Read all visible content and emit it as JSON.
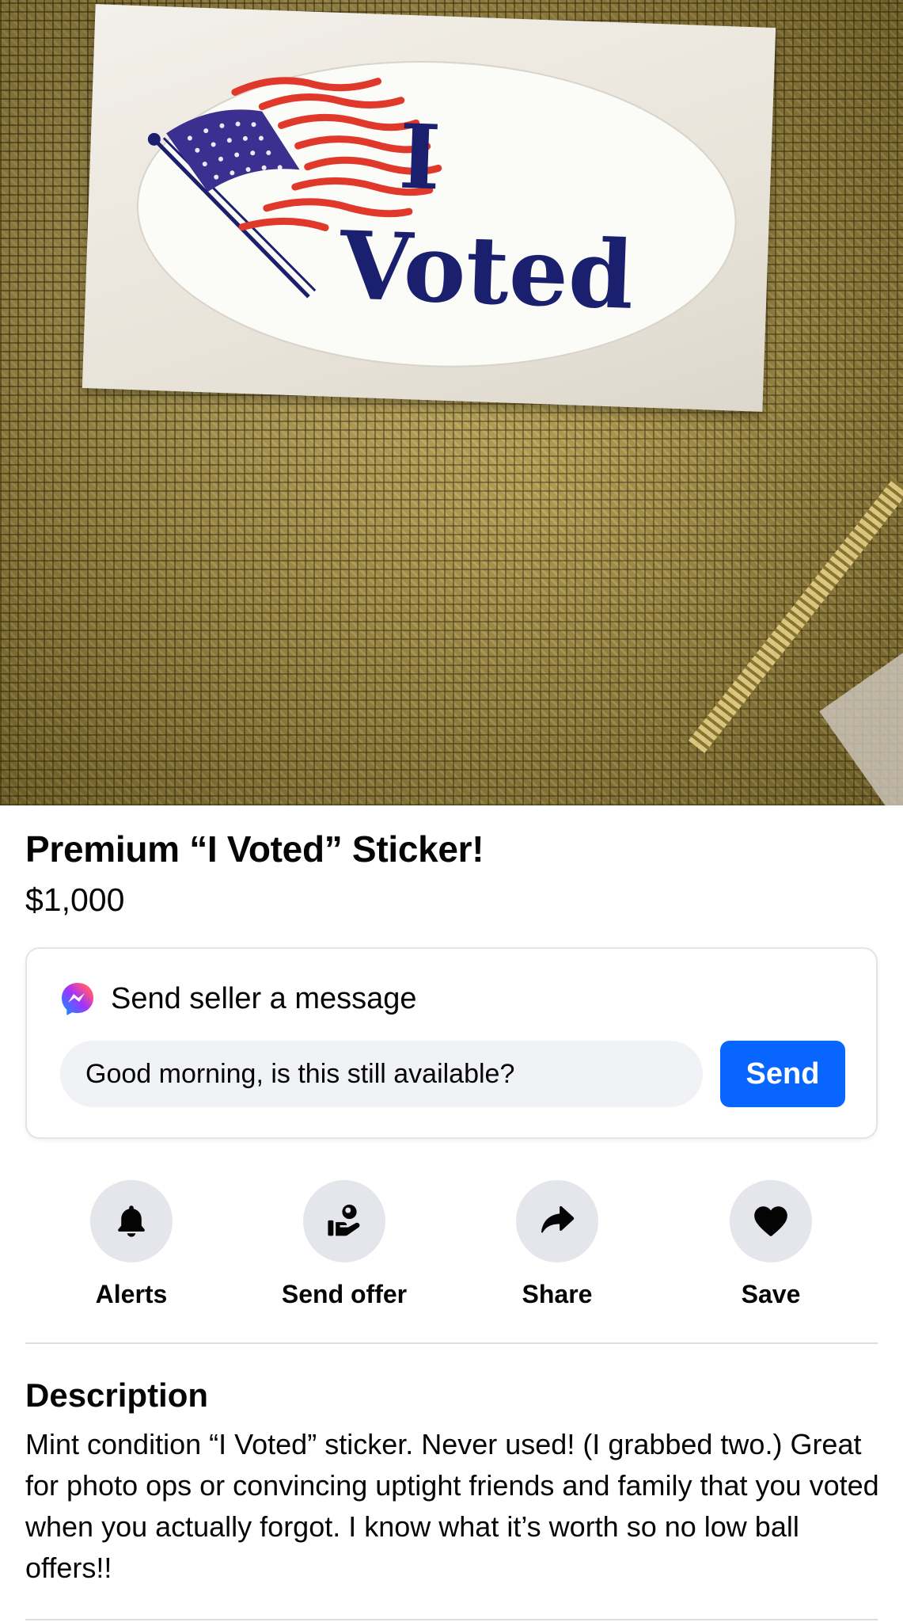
{
  "listing": {
    "sticker_text_line1": "I",
    "sticker_text_line2": "Voted",
    "title": "Premium “I Voted” Sticker!",
    "price": "$1,000"
  },
  "message": {
    "heading": "Send seller a message",
    "input_value": "Good morning, is this still available?",
    "send_label": "Send"
  },
  "actions": [
    {
      "label": "Alerts",
      "icon": "bell-icon"
    },
    {
      "label": "Send offer",
      "icon": "offer-hand-icon"
    },
    {
      "label": "Share",
      "icon": "share-arrow-icon"
    },
    {
      "label": "Save",
      "icon": "heart-icon"
    }
  ],
  "description": {
    "heading": "Description",
    "text": "Mint condition “I Voted” sticker. Never used! (I grabbed two.) Great for photo ops or convincing uptight friends and family that you voted when you actually forgot. I know what it’s worth so no low ball offers!!"
  },
  "colors": {
    "accent_blue": "#0866ff",
    "action_circle": "#e4e6eb",
    "input_bg": "#f0f2f5",
    "sticker_navy": "#1a1f6e",
    "sticker_red": "#e0392b"
  }
}
